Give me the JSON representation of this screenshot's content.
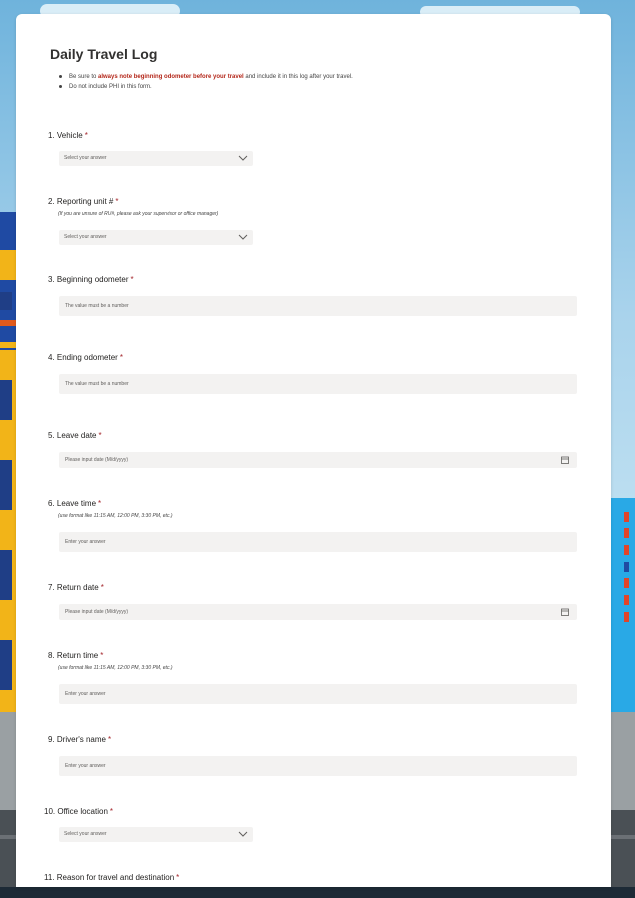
{
  "form": {
    "title": "Daily Travel Log",
    "notes": {
      "n1_pre": "Be sure to ",
      "n1_highlight": "always note beginning odometer before your travel",
      "n1_post": " and include it in this log after your travel.",
      "n2": "Do not include PHI in this form."
    },
    "required_marker": "*",
    "questions": [
      {
        "label": "1. Vehicle",
        "placeholder": "Select your answer",
        "type": "select"
      },
      {
        "label": "2. Reporting unit #",
        "sublabel": "(If you are unsure of RU#, please ask your supervisor or office manager)",
        "placeholder": "Select your answer",
        "type": "select"
      },
      {
        "label": "3. Beginning odometer",
        "placeholder": "The value must be a number",
        "type": "number"
      },
      {
        "label": "4. Ending odometer",
        "placeholder": "The value must be a number",
        "type": "number"
      },
      {
        "label": "5. Leave date",
        "placeholder": "Please input date (M/d/yyyy)",
        "type": "date"
      },
      {
        "label": "6. Leave time",
        "sublabel": "(use format like 11:15 AM, 12:00 PM, 3:30 PM, etc.)",
        "placeholder": "Enter your answer",
        "type": "text"
      },
      {
        "label": "7. Return date",
        "placeholder": "Please input date (M/d/yyyy)",
        "type": "date"
      },
      {
        "label": "8. Return time",
        "sublabel": "(use format like 11:15 AM, 12:00 PM, 3:30 PM, etc.)",
        "placeholder": "Enter your answer",
        "type": "text"
      },
      {
        "label": "9. Driver's name",
        "placeholder": "Enter your answer",
        "type": "text"
      },
      {
        "label": "10. Office location",
        "placeholder": "Select your answer",
        "type": "select"
      },
      {
        "label": "11. Reason for travel and destination",
        "type": "text"
      }
    ]
  },
  "icons": {
    "dropdown": "chevron-down-icon",
    "date": "calendar-icon"
  },
  "colors": {
    "required": "#a4262c",
    "highlight": "#b4271a",
    "field_bg": "#f3f2f1",
    "card_bg": "#ffffff"
  }
}
